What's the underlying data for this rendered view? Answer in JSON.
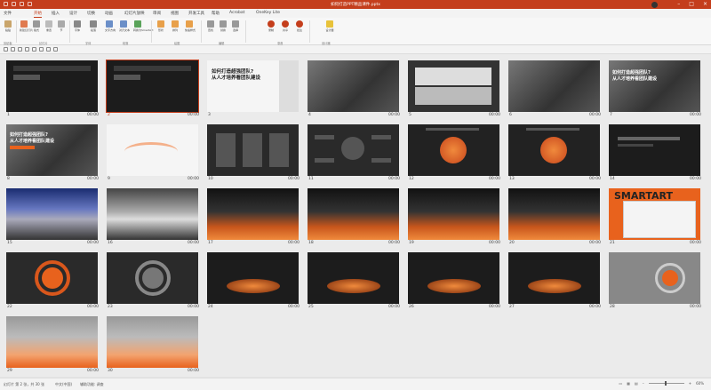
{
  "window": {
    "title": "如何打造PPT精品课件.pptx"
  },
  "tabs": [
    "文件",
    "开始",
    "插入",
    "设计",
    "切换",
    "动画",
    "幻灯片放映",
    "审阅",
    "视图",
    "开发工具",
    "帮助",
    "Acrobat",
    "OneKey Lite"
  ],
  "active_tab": "开始",
  "ribbon": {
    "buttons": [
      "粘贴",
      "新建幻灯片",
      "版式",
      "重置",
      "节",
      "字体",
      "段落",
      "文字方向",
      "对齐文本",
      "转换为SmartArt",
      "形状",
      "排列",
      "快速样式",
      "查找",
      "替换",
      "选择",
      "录制",
      "共享",
      "批注",
      "设计器"
    ],
    "groups": [
      "剪贴板",
      "幻灯片",
      "字体",
      "段落",
      "绘图",
      "编辑",
      "录音",
      "设计器"
    ]
  },
  "slides": [
    {
      "num": "1",
      "time": "00:00"
    },
    {
      "num": "2",
      "time": "00:00"
    },
    {
      "num": "3",
      "time": ""
    },
    {
      "num": "4",
      "time": "00:00"
    },
    {
      "num": "5",
      "time": "00:00"
    },
    {
      "num": "6",
      "time": "00:00"
    },
    {
      "num": "7",
      "time": "00:00"
    },
    {
      "num": "8",
      "time": "00:00"
    },
    {
      "num": "9",
      "time": "00:00"
    },
    {
      "num": "10",
      "time": "00:00"
    },
    {
      "num": "11",
      "time": "00:00"
    },
    {
      "num": "12",
      "time": "00:00"
    },
    {
      "num": "13",
      "time": "00:00"
    },
    {
      "num": "14",
      "time": "00:00"
    },
    {
      "num": "15",
      "time": "00:00"
    },
    {
      "num": "16",
      "time": "00:00"
    },
    {
      "num": "17",
      "time": "00:00"
    },
    {
      "num": "18",
      "time": "00:00"
    },
    {
      "num": "19",
      "time": "00:00"
    },
    {
      "num": "20",
      "time": "00:00"
    },
    {
      "num": "21",
      "time": "00:00"
    },
    {
      "num": "22",
      "time": "00:00"
    },
    {
      "num": "23",
      "time": "00:00"
    },
    {
      "num": "24",
      "time": "00:00"
    },
    {
      "num": "25",
      "time": "00:00"
    },
    {
      "num": "26",
      "time": "00:00"
    },
    {
      "num": "27",
      "time": "00:00"
    },
    {
      "num": "28",
      "time": "00:00"
    },
    {
      "num": "29",
      "time": "00:00"
    },
    {
      "num": "30",
      "time": "00:00"
    }
  ],
  "slide_text": {
    "s7_title": "如何打造超强团队?",
    "s7_sub": "从人才培养看团队建设",
    "s3_title": "如何打造超强团队?",
    "s3_sub": "从人才培养看团队建设",
    "s8_title": "如何打造超强团队?",
    "s8_sub": "从人才培养看团队建设",
    "s21_word": "SMARTART"
  },
  "statusbar": {
    "slide_info": "幻灯片 第 2 张，共 30 张",
    "language": "中文(中国)",
    "accessibility": "辅助功能: 调查",
    "zoom": "60%"
  }
}
